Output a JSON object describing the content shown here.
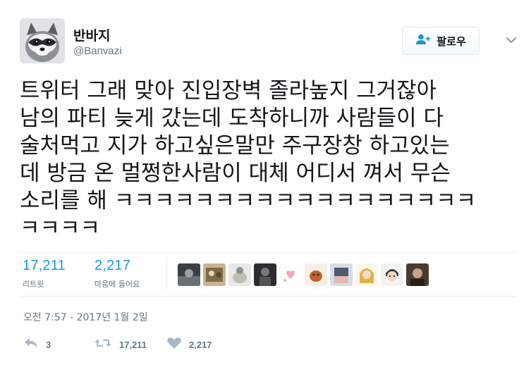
{
  "user": {
    "display_name": "반바지",
    "handle": "@Banvazi"
  },
  "follow_button": {
    "label": "팔로우"
  },
  "tweet": {
    "lines": [
      "트위터 그래 맞아 진입장벽 졸라높지 그거잖아",
      "남의 파티 늦게 갔는데 도착하니까 사람들이 다",
      "술처먹고 지가 하고싶은말만 주구장창 하고있는",
      "데 방금 온 멀쩡한사람이 대체 어디서 껴서 무슨",
      "소리를 해 ㅋㅋㅋㅋㅋㅋㅋㅋㅋㅋㅋㅋㅋㅋㅋㅋㅋㅋ",
      "ㅋㅋㅋㅋ"
    ]
  },
  "stats": {
    "retweets": {
      "value": "17,211",
      "label": "리트윗"
    },
    "likes": {
      "value": "2,217",
      "label": "마음에 들어요"
    }
  },
  "timestamp": "오전 7:57 - 2017년 1월 2일",
  "actions": {
    "reply_count": "3",
    "retweet_count": "17,211",
    "like_count": "2,217"
  },
  "icons": {
    "avatar": "raccoon-avatar",
    "follow": "add-user-icon",
    "menu": "chevron-down-icon",
    "reply": "reply-icon",
    "retweet": "retweet-icon",
    "like": "heart-icon"
  },
  "colors": {
    "accent": "#1b95e0",
    "muted": "#657786",
    "text": "#14171a",
    "border": "#e6ecf0"
  }
}
